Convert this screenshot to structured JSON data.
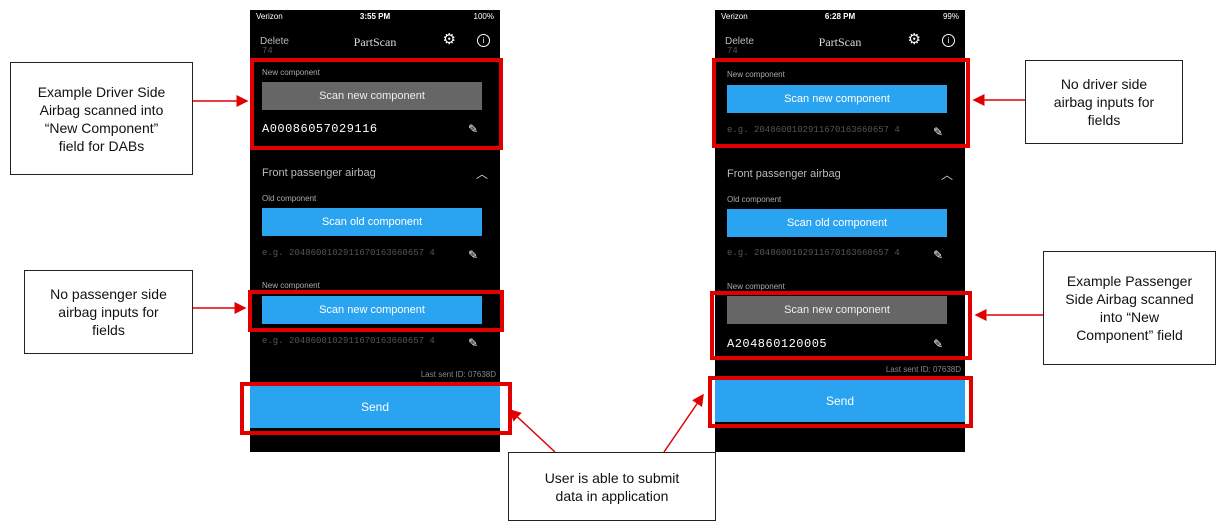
{
  "phones": {
    "left": {
      "status": {
        "carrier": "Verizon",
        "time": "3:55 PM",
        "battery": "100%"
      },
      "nav": {
        "delete": "Delete",
        "title": "PartScan"
      },
      "top_overflow": "74",
      "new_component_label": "New component",
      "scan_new_button": "Scan new component",
      "new_component_value": "A00086057029116",
      "section_title": "Front passenger airbag",
      "old_component_label": "Old component",
      "scan_old_button": "Scan old component",
      "old_placeholder": "e.g. 2048600102911670163660657 4",
      "new_component_label_2": "New component",
      "scan_new_button_2": "Scan new component",
      "new_placeholder_2": "e.g. 2048600102911670163660657 4",
      "last_sent": "Last sent ID: 07638D",
      "send_button": "Send"
    },
    "right": {
      "status": {
        "carrier": "Verizon",
        "time": "6:28 PM",
        "battery": "99%"
      },
      "nav": {
        "delete": "Delete",
        "title": "PartScan"
      },
      "top_overflow": "74",
      "new_component_label": "New component",
      "scan_new_button": "Scan new component",
      "new_placeholder": "e.g. 2048600102911670163660657 4",
      "section_title": "Front passenger airbag",
      "old_component_label": "Old component",
      "scan_old_button": "Scan old component",
      "old_placeholder": "e.g. 2048600102911670163660657 4",
      "new_component_label_2": "New component",
      "scan_new_button_2": "Scan new component",
      "new_component_value_2": "A204860120005",
      "last_sent": "Last sent ID: 07638D",
      "send_button": "Send"
    }
  },
  "callouts": {
    "driver_example": "Example Driver Side\nAirbag scanned into\n“New Component”\nfield for DABs",
    "no_passenger": "No passenger side\nairbag inputs for\nfields",
    "no_driver": "No driver side\nairbag inputs for\nfields",
    "passenger_example": "Example Passenger\nSide Airbag scanned\ninto “New\nComponent” field",
    "submit": "User is able to submit\ndata in application"
  },
  "colors": {
    "accent_blue": "#2aa4f0",
    "highlight_red": "#e00000",
    "scan_gray": "#666666"
  },
  "icons": [
    "gear-icon",
    "info-icon",
    "pencil-icon",
    "chevron-up-icon",
    "signal-icon",
    "wifi-icon",
    "battery-icon"
  ]
}
